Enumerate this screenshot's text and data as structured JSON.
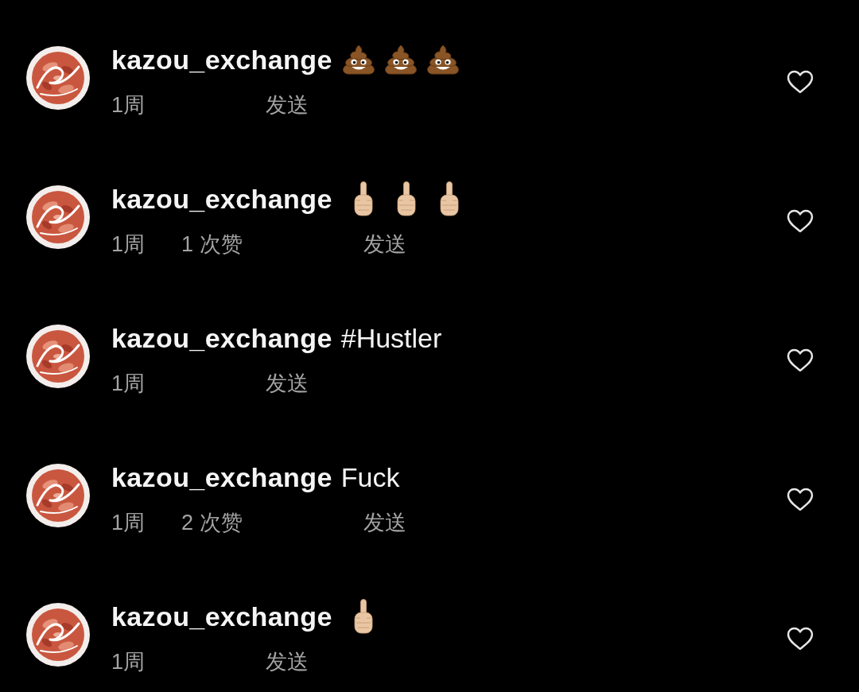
{
  "comments": [
    {
      "username": "kazou_exchange",
      "emojis": [
        {
          "kind": "poop"
        },
        {
          "kind": "poop"
        },
        {
          "kind": "poop"
        }
      ],
      "time": "1周",
      "reply": "发送",
      "liked": false
    },
    {
      "username": "kazou_exchange",
      "emojis": [
        {
          "kind": "middle_finger"
        },
        {
          "kind": "middle_finger"
        },
        {
          "kind": "middle_finger"
        }
      ],
      "time": "1周",
      "likes": "1 次赞",
      "reply": "发送",
      "liked": false
    },
    {
      "username": "kazou_exchange",
      "text": "#Hustler",
      "time": "1周",
      "reply": "发送",
      "liked": false
    },
    {
      "username": "kazou_exchange",
      "text": "Fuck",
      "time": "1周",
      "likes": "2 次赞",
      "reply": "发送",
      "liked": false
    },
    {
      "username": "kazou_exchange",
      "emojis": [
        {
          "kind": "middle_finger"
        }
      ],
      "time": "1周",
      "reply": "发送",
      "liked": false
    }
  ]
}
